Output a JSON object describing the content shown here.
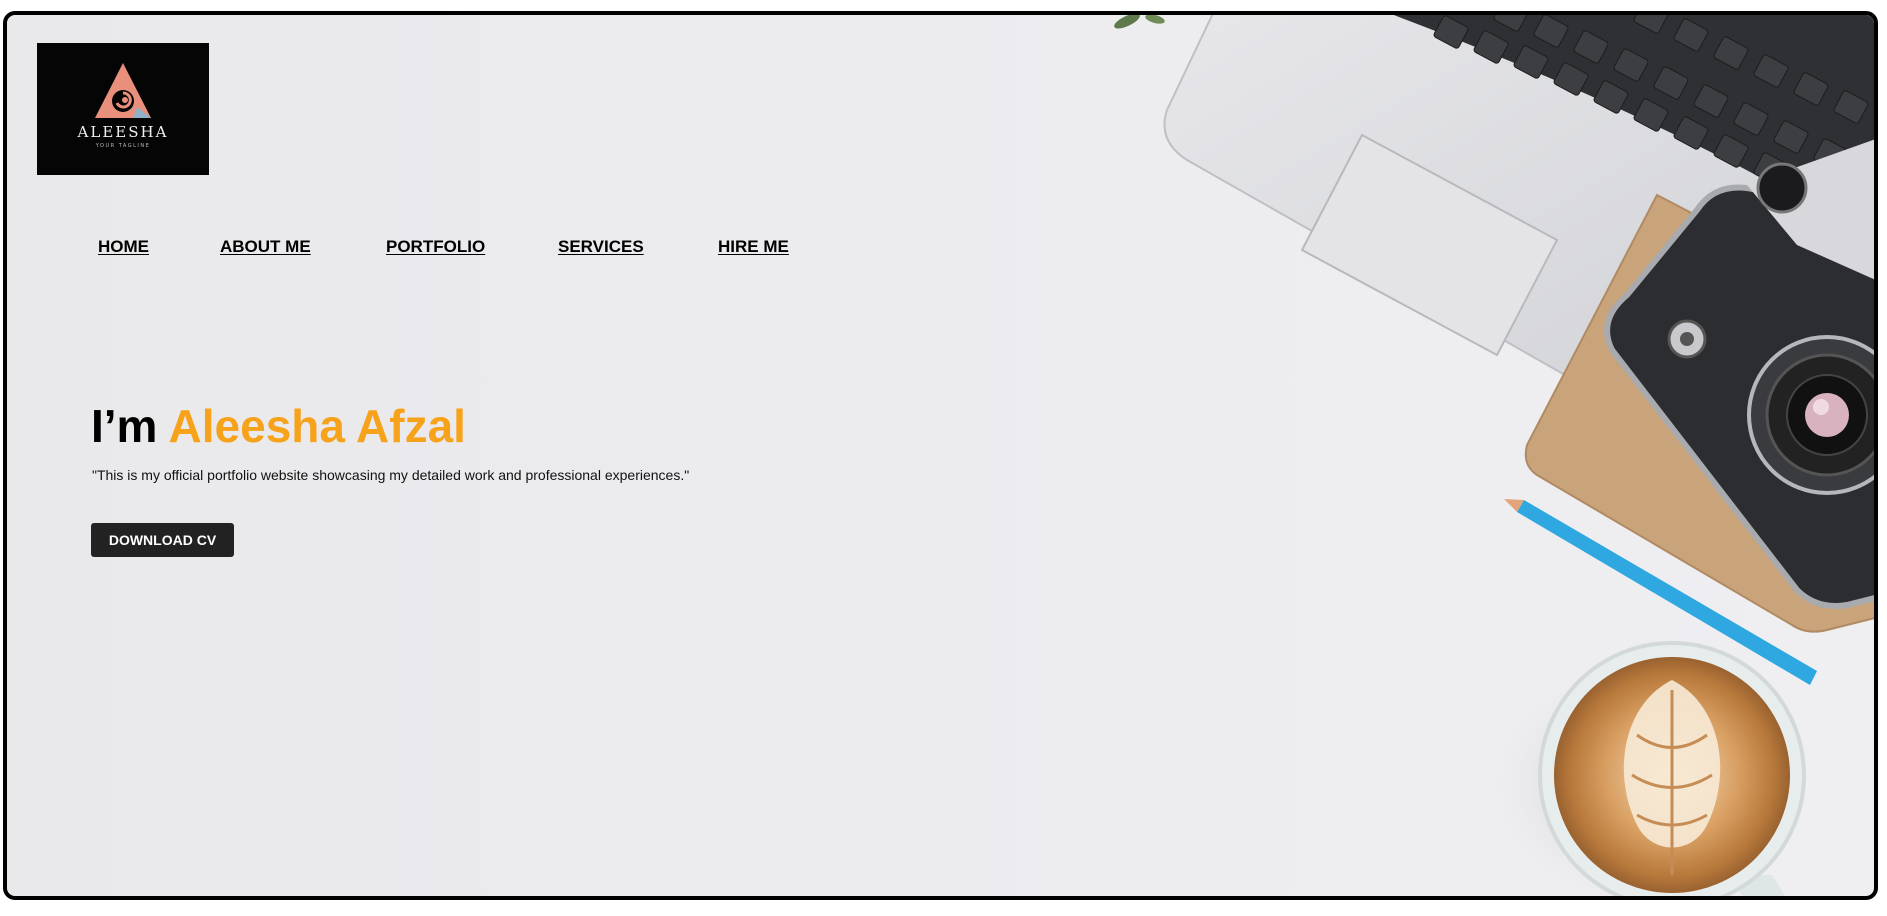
{
  "logo": {
    "name": "ALEESHA",
    "tagline": "YOUR TAGLINE",
    "icon": "triangle-swirl-icon"
  },
  "nav": {
    "items": [
      {
        "label": "HOME"
      },
      {
        "label": "ABOUT ME"
      },
      {
        "label": "PORTFOLIO"
      },
      {
        "label": "SERVICES"
      },
      {
        "label": "HIRE ME"
      }
    ]
  },
  "hero": {
    "greeting": "I’m",
    "name": "Aleesha Afzal",
    "description": "\"This is my official portfolio website showcasing my detailed work and professional experiences.\"",
    "cta_label": "DOWNLOAD CV"
  },
  "colors": {
    "accent": "#f7a21b",
    "button_bg": "#222222",
    "text": "#000000"
  },
  "background": {
    "illustration": [
      "laptop-icon",
      "camera-icon",
      "notebook-icon",
      "pencil-icon",
      "coffee-cup-icon"
    ]
  }
}
